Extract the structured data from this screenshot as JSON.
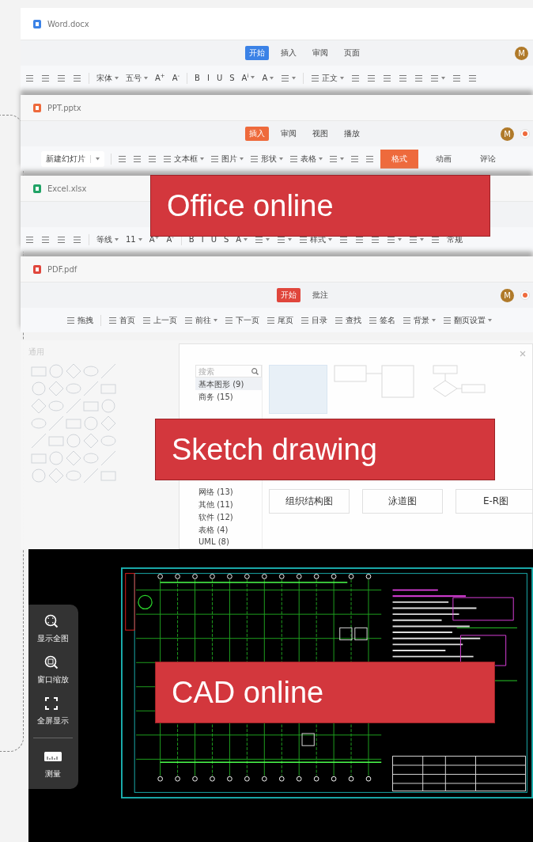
{
  "windows": [
    {
      "kind": "word",
      "file": "Word.docx",
      "color": "#3b82e6",
      "avatar": "M",
      "tabs": [
        {
          "label": "开始",
          "selected": true
        },
        {
          "label": "插入",
          "selected": false
        },
        {
          "label": "审阅",
          "selected": false
        },
        {
          "label": "页面",
          "selected": false
        }
      ],
      "toolbar": [
        {
          "kind": "icon"
        },
        {
          "kind": "icon"
        },
        {
          "kind": "icon"
        },
        {
          "kind": "icon"
        },
        {
          "kind": "sep"
        },
        {
          "kind": "text",
          "label": "宋体",
          "dropdown": true
        },
        {
          "kind": "text",
          "label": "五号",
          "dropdown": true
        },
        {
          "kind": "text",
          "label": "A$^{+}$"
        },
        {
          "kind": "text",
          "label": "A$^{-}$"
        },
        {
          "kind": "sep"
        },
        {
          "kind": "text",
          "label": "B"
        },
        {
          "kind": "text",
          "label": "I"
        },
        {
          "kind": "text",
          "label": "U"
        },
        {
          "kind": "text",
          "label": "S"
        },
        {
          "kind": "text",
          "label": "A$^{i}$",
          "dropdown": true
        },
        {
          "kind": "text",
          "label": "A",
          "dropdown": true
        },
        {
          "kind": "icon",
          "dropdown": true
        },
        {
          "kind": "sep"
        },
        {
          "kind": "text",
          "label": "正文",
          "icon": true,
          "dropdown": true
        },
        {
          "kind": "icon"
        },
        {
          "kind": "icon"
        },
        {
          "kind": "icon"
        },
        {
          "kind": "icon"
        },
        {
          "kind": "icon"
        },
        {
          "kind": "icon",
          "dropdown": true
        },
        {
          "kind": "icon"
        },
        {
          "kind": "icon"
        }
      ]
    },
    {
      "kind": "ppt",
      "file": "PPT.pptx",
      "color": "#ee6a3c",
      "avatar": "M",
      "tabs": [
        {
          "label": "插入",
          "selected": true
        },
        {
          "label": "审阅",
          "selected": false
        },
        {
          "label": "视图",
          "selected": false
        },
        {
          "label": "播放",
          "selected": false
        }
      ],
      "toolbar": [
        {
          "kind": "field",
          "label": "新建幻灯片",
          "dropdown": true
        },
        {
          "kind": "sep"
        },
        {
          "kind": "icon"
        },
        {
          "kind": "icon"
        },
        {
          "kind": "icon"
        },
        {
          "kind": "text",
          "label": "文本框",
          "icon": true,
          "dropdown": true
        },
        {
          "kind": "text",
          "label": "图片",
          "icon": true,
          "dropdown": true
        },
        {
          "kind": "text",
          "label": "形状",
          "icon": true,
          "dropdown": true
        },
        {
          "kind": "text",
          "label": "表格",
          "icon": true,
          "dropdown": true
        },
        {
          "kind": "icon",
          "dropdown": true
        },
        {
          "kind": "icon"
        },
        {
          "kind": "icon"
        },
        {
          "kind": "button",
          "label": "格式",
          "selected": true
        },
        {
          "kind": "button",
          "label": "动画",
          "selected": false
        },
        {
          "kind": "button",
          "label": "评论",
          "selected": false
        }
      ]
    },
    {
      "kind": "excel",
      "file": "Excel.xlsx",
      "color": "#21a366",
      "toolbar": [
        {
          "kind": "icon"
        },
        {
          "kind": "icon"
        },
        {
          "kind": "icon"
        },
        {
          "kind": "icon"
        },
        {
          "kind": "sep"
        },
        {
          "kind": "text",
          "label": "等线",
          "dropdown": true
        },
        {
          "kind": "text",
          "label": "11",
          "dropdown": true
        },
        {
          "kind": "text",
          "label": "A$^{+}$"
        },
        {
          "kind": "text",
          "label": "A$^{-}$"
        },
        {
          "kind": "sep"
        },
        {
          "kind": "text",
          "label": "B"
        },
        {
          "kind": "text",
          "label": "I"
        },
        {
          "kind": "text",
          "label": "U"
        },
        {
          "kind": "text",
          "label": "S"
        },
        {
          "kind": "text",
          "label": "A",
          "dropdown": true
        },
        {
          "kind": "icon",
          "dropdown": true
        },
        {
          "kind": "icon",
          "dropdown": true
        },
        {
          "kind": "text",
          "label": "样式",
          "icon": true,
          "dropdown": true
        },
        {
          "kind": "icon"
        },
        {
          "kind": "icon"
        },
        {
          "kind": "icon"
        },
        {
          "kind": "icon",
          "dropdown": true
        },
        {
          "kind": "icon",
          "dropdown": true
        },
        {
          "kind": "icon"
        },
        {
          "kind": "text",
          "label": "常规"
        }
      ]
    },
    {
      "kind": "pdf",
      "file": "PDF.pdf",
      "color": "#e0463c",
      "avatar": "M",
      "tabs": [
        {
          "label": "开始",
          "selected": true
        },
        {
          "label": "批注",
          "selected": false
        }
      ],
      "toolbar": [
        {
          "kind": "text",
          "label": "拖拽",
          "icon": true
        },
        {
          "kind": "sep"
        },
        {
          "kind": "text",
          "label": "首页",
          "icon": true
        },
        {
          "kind": "text",
          "label": "上一页",
          "icon": true
        },
        {
          "kind": "text",
          "label": "前往",
          "icon": true,
          "dropdown": true
        },
        {
          "kind": "text",
          "label": "下一页",
          "icon": true
        },
        {
          "kind": "text",
          "label": "尾页",
          "icon": true
        },
        {
          "kind": "text",
          "label": "目录",
          "icon": true
        },
        {
          "kind": "text",
          "label": "查找",
          "icon": true
        },
        {
          "kind": "text",
          "label": "签名",
          "icon": true
        },
        {
          "kind": "text",
          "label": "背景",
          "icon": true,
          "dropdown": true
        },
        {
          "kind": "text",
          "label": "翻页设置",
          "icon": true,
          "dropdown": true
        }
      ]
    }
  ],
  "sketch": {
    "palette_title": "通用",
    "search": {
      "placeholder": "搜索"
    },
    "categories_top": [
      {
        "label": "基本图形 (9)",
        "selected": true
      },
      {
        "label": "商务 (15)",
        "selected": false
      }
    ],
    "categories_bottom": [
      {
        "label": "网络 (13)",
        "selected": false
      },
      {
        "label": "其他 (11)",
        "selected": false
      },
      {
        "label": "软件 (12)",
        "selected": false
      },
      {
        "label": "表格 (4)",
        "selected": false
      },
      {
        "label": "UML (8)",
        "selected": false
      }
    ],
    "templates": [
      {
        "label": "组织结构图"
      },
      {
        "label": "泳道图"
      },
      {
        "label": "E-R图"
      }
    ]
  },
  "cad": {
    "tools": [
      {
        "kind": "extents",
        "label": "显示全图"
      },
      {
        "kind": "window",
        "label": "窗口缩放"
      },
      {
        "kind": "fullscreen",
        "label": "全屏显示"
      },
      {
        "kind": "measure",
        "label": "测量"
      }
    ]
  },
  "labels": [
    {
      "text": "Office online"
    },
    {
      "text": "Sketch drawing"
    },
    {
      "text": "CAD online"
    }
  ]
}
